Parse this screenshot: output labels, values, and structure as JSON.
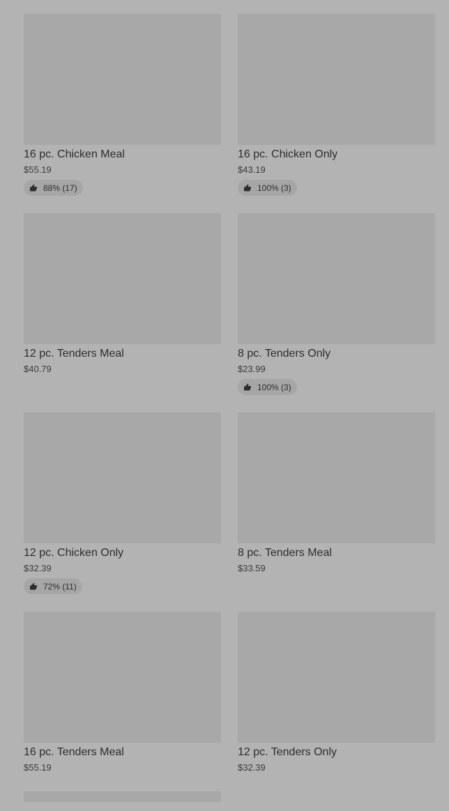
{
  "menu": {
    "items": [
      {
        "title": "16 pc. Chicken Meal",
        "price": "$55.19",
        "rating": "88% (17)"
      },
      {
        "title": "16 pc. Chicken Only",
        "price": "$43.19",
        "rating": "100% (3)"
      },
      {
        "title": "12 pc. Tenders Meal",
        "price": "$40.79",
        "rating": null
      },
      {
        "title": "8 pc. Tenders Only",
        "price": "$23.99",
        "rating": "100% (3)"
      },
      {
        "title": "12 pc. Chicken Only",
        "price": "$32.39",
        "rating": "72% (11)"
      },
      {
        "title": "8 pc. Tenders Meal",
        "price": "$33.59",
        "rating": null
      },
      {
        "title": "16 pc. Tenders Meal",
        "price": "$55.19",
        "rating": null
      },
      {
        "title": "12 pc. Tenders Only",
        "price": "$32.39",
        "rating": null
      }
    ],
    "rating_icon": "thumbs-up-icon"
  },
  "colors": {
    "background": "#b3b3b3",
    "image_placeholder": "#a8a8a8",
    "text": "#2d2d2d",
    "badge": "#a6a6a6"
  }
}
